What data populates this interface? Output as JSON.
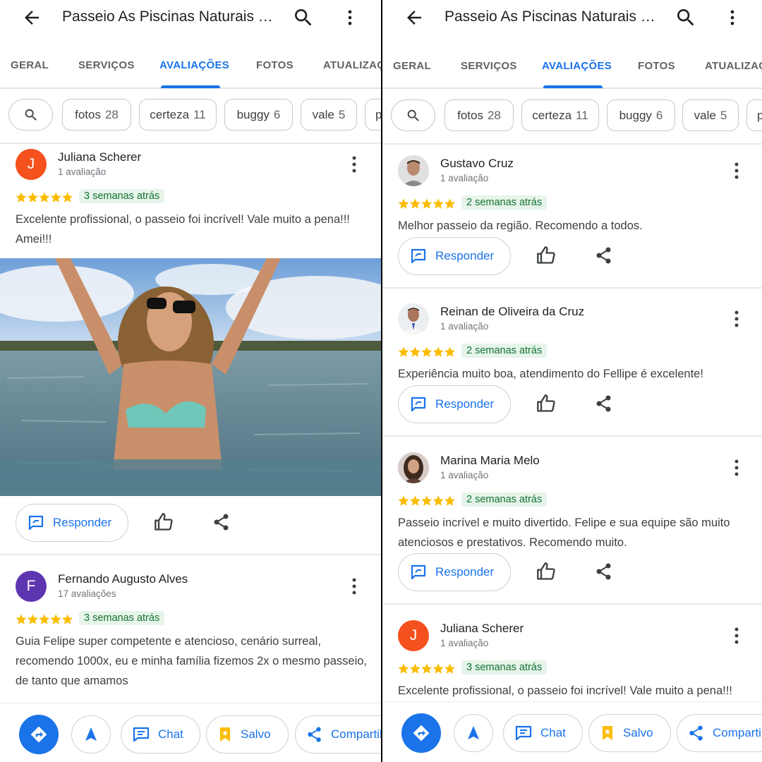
{
  "header": {
    "title": "Passeio As Piscinas Naturais D..."
  },
  "tabs": [
    "GERAL",
    "SERVIÇOS",
    "AVALIAÇÕES",
    "FOTOS",
    "ATUALIZAÇÕES"
  ],
  "active_tab": "AVALIAÇÕES",
  "chips": [
    {
      "label": "fotos",
      "count": "28"
    },
    {
      "label": "certeza",
      "count": "11"
    },
    {
      "label": "buggy",
      "count": "6"
    },
    {
      "label": "vale",
      "count": "5"
    },
    {
      "label": "p",
      "count": ""
    }
  ],
  "actions": {
    "reply_label": "Responder"
  },
  "bottom_bar": {
    "chat_label": "Chat",
    "saved_label": "Salvo",
    "share_label": "Compartilhar"
  },
  "left_reviews": [
    {
      "author": "Juliana Scherer",
      "initial": "J",
      "count": "1 avaliação",
      "rating": 5,
      "when": "3 semanas atrás",
      "text": "Excelente profissional, o passeio foi incrível! Vale muito a pena!!! Amei!!!"
    },
    {
      "author": "Fernando Augusto Alves",
      "initial": "F",
      "count": "17 avaliações",
      "rating": 5,
      "when": "3 semanas atrás",
      "text": "Guia Felipe super competente e atencioso, cenário surreal, recomendo 1000x, eu e minha família fizemos 2x o mesmo passeio, de tanto que amamos"
    }
  ],
  "right_reviews": [
    {
      "author": "Gustavo Cruz",
      "count": "1 avaliação",
      "rating": 5,
      "when": "2 semanas atrás",
      "text": "Melhor passeio da região. Recomendo a todos."
    },
    {
      "author": "Reinan de Oliveira da Cruz",
      "count": "1 avaliação",
      "rating": 5,
      "when": "2 semanas atrás",
      "text": "Experiência muito boa, atendimento do Fellipe é excelente!"
    },
    {
      "author": "Marina Maria Melo",
      "count": "1 avaliação",
      "rating": 5,
      "when": "2 semanas atrás",
      "text": "Passeio incrível e muito divertido. Felipe e sua equipe são muito atenciosos e prestativos. Recomendo muito."
    },
    {
      "author": "Juliana Scherer",
      "initial": "J",
      "count": "1 avaliação",
      "rating": 5,
      "when": "3 semanas atrás",
      "text": "Excelente profissional, o passeio foi incrível! Vale muito a pena!!!"
    }
  ],
  "colors": {
    "accent": "#1a73e8",
    "star": "#fbbc04",
    "badge_bg": "#e6f4ea",
    "badge_text": "#137333",
    "avatar_orange": "#f4511e",
    "avatar_purple": "#5e35b1"
  },
  "icons": [
    "back-arrow-icon",
    "search-icon",
    "more-vert-icon",
    "reply-icon",
    "thumbs-up-icon",
    "share-icon",
    "directions-icon",
    "navigation-arrow-icon",
    "chat-icon",
    "bookmark-icon"
  ]
}
